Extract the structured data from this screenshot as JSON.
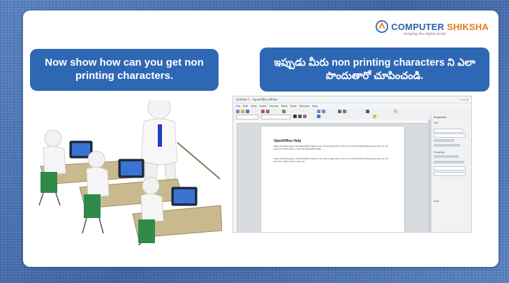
{
  "logo": {
    "brand_primary": "COMPUTER",
    "brand_secondary": "SHIKSHA",
    "tagline": "bridging the digital divide",
    "colors": {
      "primary": "#2d62a8",
      "secondary": "#e07b1f"
    }
  },
  "slide": {
    "english_instruction": "Now show how can you get non printing characters.",
    "telugu_instruction": "ఇప్పుడు మీరు non printing characters ని ఎలా పొందుతారో చూపించండి.",
    "bubble_color": "#2e68b4"
  },
  "illustration": {
    "icon": "classroom-illustration"
  },
  "screenshot": {
    "window_title": "Untitled 1 - OpenOffice Writer",
    "menu": [
      "File",
      "Edit",
      "View",
      "Insert",
      "Format",
      "Table",
      "Tools",
      "Window",
      "Help"
    ],
    "document": {
      "heading": "OpenOffice Help",
      "paragraph_1": "Opens the main page of the OpenOffice Help for the current application. You can scroll through the Help pages and you can search for index terms or any text OpenOffice Help",
      "paragraph_2": "Opens the main page of the OpenOffice Help for the current application. You can scroll through the Help pages and you can search for index terms or any text."
    },
    "sidebar": {
      "title": "Properties",
      "sections": [
        "Text",
        "Paragraph",
        "Page"
      ]
    }
  }
}
